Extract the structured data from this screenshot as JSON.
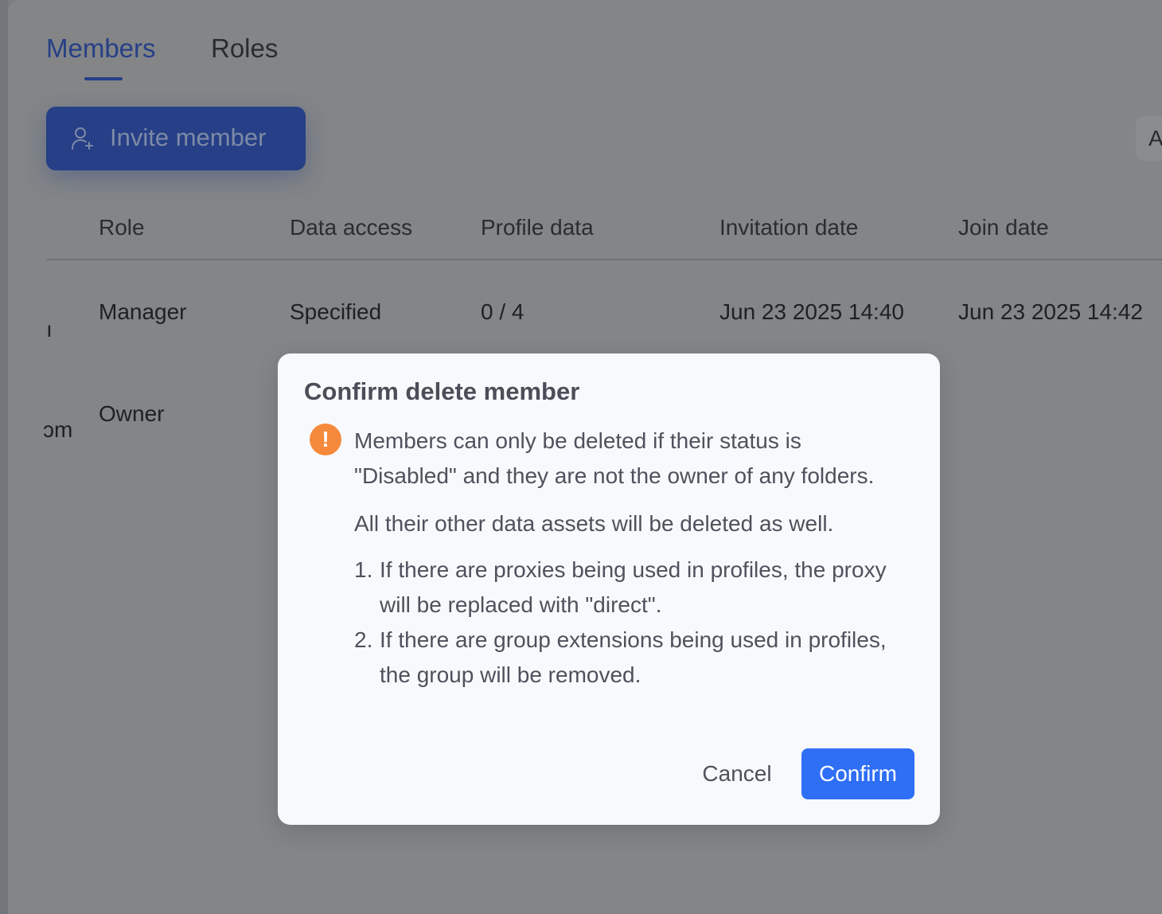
{
  "tabs": [
    {
      "label": "Members",
      "active": true
    },
    {
      "label": "Roles",
      "active": false
    }
  ],
  "toolbar": {
    "invite_label": "Invite member",
    "invite_icon": "user-plus-icon",
    "right_partial": "A"
  },
  "table": {
    "headers": [
      "Role",
      "Data access",
      "Profile data",
      "Invitation date",
      "Join date"
    ],
    "rows": [
      {
        "partial_first": "ı",
        "role": "Manager",
        "data_access": "Specified",
        "profile_data": "0 / 4",
        "invitation_date": "Jun 23 2025 14:40",
        "join_date": "Jun 23 2025 14:42"
      },
      {
        "partial_first": "ɔm",
        "role": "Owner",
        "data_access": "",
        "profile_data": "",
        "invitation_date": "",
        "join_date": ""
      }
    ]
  },
  "modal": {
    "title": "Confirm delete member",
    "warning_icon": "exclamation-icon",
    "warning_color": "#f58a3c",
    "paragraph1": "Members can only be deleted if their status is \"Disabled\" and they are not the owner of any folders.",
    "paragraph2": "All their other data assets will be deleted as well.",
    "list": [
      {
        "num": "1.",
        "text": "If there are proxies being used in profiles, the proxy will be replaced with \"direct\"."
      },
      {
        "num": "2.",
        "text": "If there are group extensions being used in profiles, the group will be removed."
      }
    ],
    "cancel_label": "Cancel",
    "confirm_label": "Confirm",
    "confirm_color": "#2f6ff5"
  }
}
